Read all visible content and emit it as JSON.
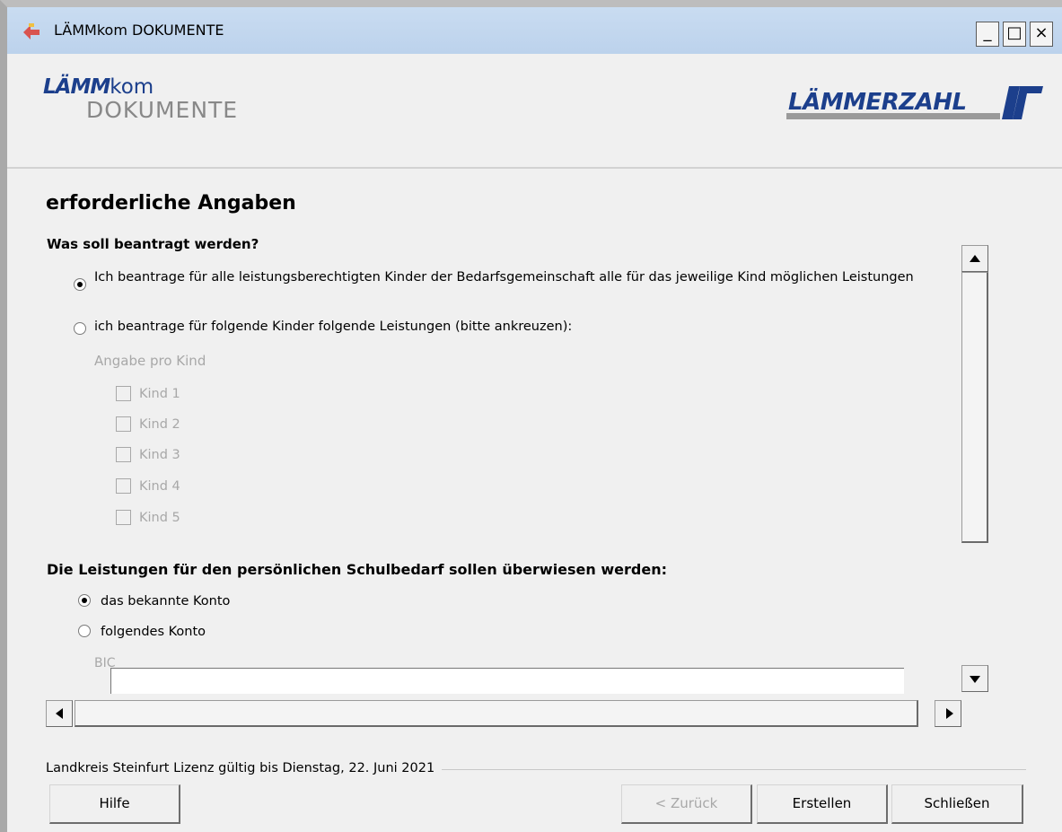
{
  "window": {
    "title": "LÄMMkom DOKUMENTE",
    "controls": {
      "minimize": "_",
      "maximize": "□",
      "close": "×"
    }
  },
  "header": {
    "logo_left": {
      "brand_a": "LÄMM",
      "brand_b": "kom",
      "subtitle": "DOKUMENTE"
    },
    "logo_right": {
      "text": "LÄMMERZAHL"
    }
  },
  "form": {
    "section_title": "erforderliche Angaben",
    "question1": {
      "heading": "Was soll beantragt werden?",
      "options": [
        {
          "label": "Ich beantrage für alle leistungsberechtigten Kinder der Bedarfsgemeinschaft alle für das jeweilige Kind möglichen Leistungen",
          "checked": true
        },
        {
          "label": "ich beantrage für folgende Kinder folgende Leistungen (bitte ankreuzen):",
          "checked": false
        }
      ],
      "sub_label": "Angabe pro Kind",
      "children": [
        {
          "label": "Kind 1",
          "checked": false
        },
        {
          "label": "Kind 2",
          "checked": false
        },
        {
          "label": "Kind 3",
          "checked": false
        },
        {
          "label": "Kind 4",
          "checked": false
        },
        {
          "label": "Kind 5",
          "checked": false
        }
      ]
    },
    "question2": {
      "heading": "Die Leistungen für den persönlichen Schulbedarf sollen überwiesen werden:",
      "options": [
        {
          "label": "das bekannte Konto",
          "checked": true
        },
        {
          "label": "folgendes Konto",
          "checked": false
        }
      ],
      "bic_label": "BIC",
      "bic_value": ""
    }
  },
  "footer": {
    "license": "Landkreis Steinfurt Lizenz gültig bis Dienstag, 22. Juni 2021",
    "buttons": {
      "help": "Hilfe",
      "back": "< Zurück",
      "create": "Erstellen",
      "close": "Schließen"
    }
  },
  "colors": {
    "titlebar": "#c4d8ef",
    "logo_blue": "#1c3f8c",
    "logo_gray": "#888888",
    "disabled_text": "#a8a8a8",
    "background": "#f0f0f0"
  },
  "icons": {
    "app": "app-icon",
    "minimize": "minimize-icon",
    "maximize": "maximize-icon",
    "close": "close-icon",
    "scroll_up": "arrow-up-icon",
    "scroll_down": "arrow-down-icon",
    "scroll_left": "arrow-left-icon",
    "scroll_right": "arrow-right-icon"
  }
}
